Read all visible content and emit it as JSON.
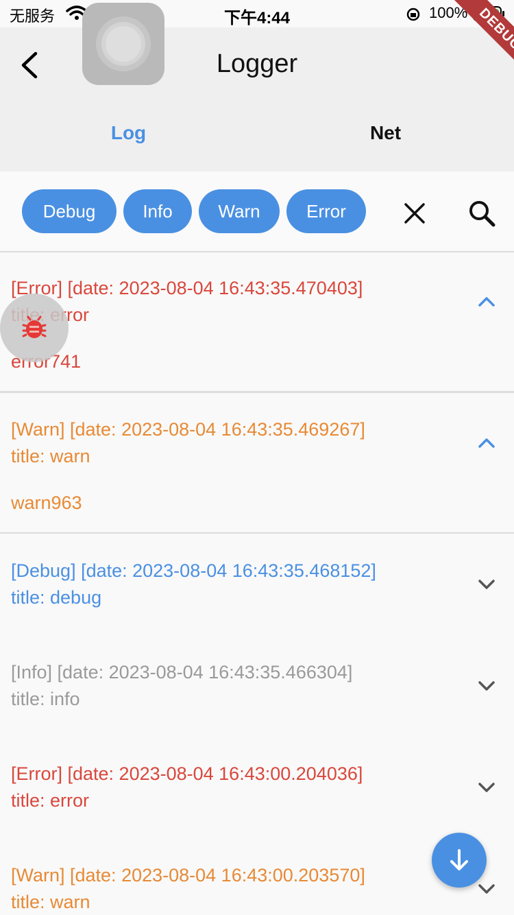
{
  "status_bar": {
    "carrier": "无服务",
    "time": "下午4:44",
    "battery": "100%"
  },
  "debug_banner": "DEBUG",
  "app_bar": {
    "title": "Logger",
    "back_icon": "chevron-left-icon"
  },
  "tabs": [
    {
      "label": "Log",
      "selected": true
    },
    {
      "label": "Net",
      "selected": false
    }
  ],
  "filters": {
    "chips": [
      "Debug",
      "Info",
      "Warn",
      "Error"
    ],
    "clear_icon": "close-icon",
    "search_icon": "search-icon"
  },
  "logs": [
    {
      "level": "error",
      "header": "[Error] [date: 2023-08-04 16:43:35.470403]",
      "title": "title: error",
      "message": "error741",
      "expanded": true
    },
    {
      "level": "warn",
      "header": "[Warn] [date: 2023-08-04 16:43:35.469267]",
      "title": "title: warn",
      "message": "warn963",
      "expanded": true
    },
    {
      "level": "debug",
      "header": "[Debug] [date: 2023-08-04 16:43:35.468152]",
      "title": "title: debug",
      "expanded": false
    },
    {
      "level": "info",
      "header": "[Info] [date: 2023-08-04 16:43:35.466304]",
      "title": "title: info",
      "expanded": false
    },
    {
      "level": "error",
      "header": "[Error] [date: 2023-08-04 16:43:00.204036]",
      "title": "title: error",
      "expanded": false
    },
    {
      "level": "warn",
      "header": "[Warn] [date: 2023-08-04 16:43:00.203570]",
      "title": "title: warn",
      "expanded": false
    }
  ],
  "colors": {
    "accent": "#4a90e2",
    "error": "#d9473c",
    "warn": "#e78a35",
    "debug": "#4a90e2",
    "info": "#9a9a9a"
  },
  "floating": {
    "bug_icon": "bug-icon",
    "scroll_down_icon": "arrow-down-icon"
  }
}
